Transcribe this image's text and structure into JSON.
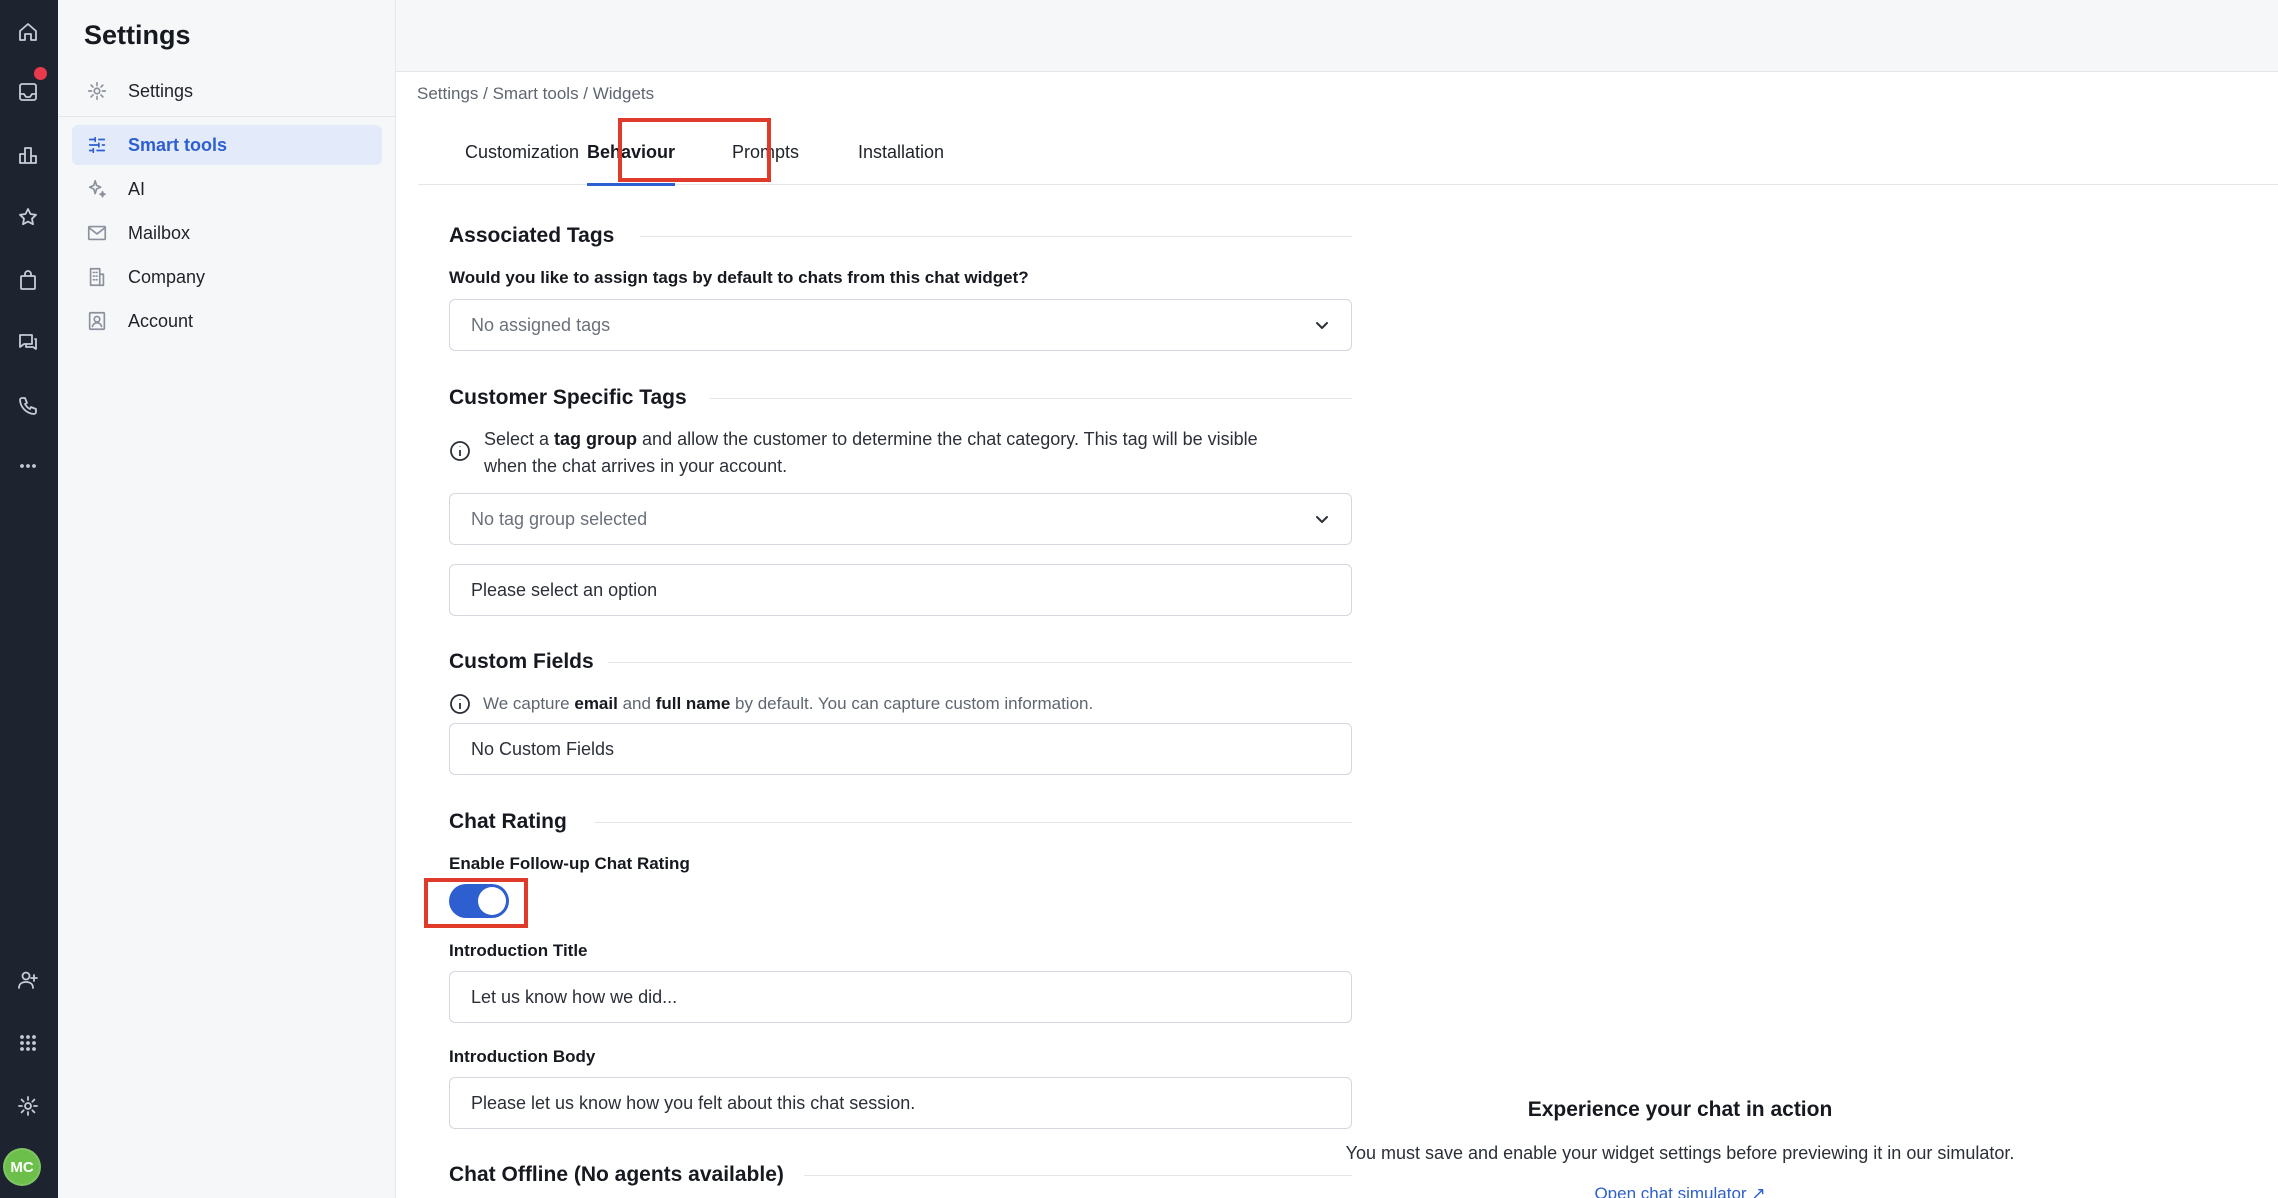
{
  "rail": {
    "icons": [
      "home-icon",
      "inbox-icon",
      "reports-icon",
      "star-icon",
      "shopping-bag-icon",
      "chat-icon",
      "phone-icon",
      "more-icon",
      "add-user-icon",
      "apps-grid-icon",
      "gear-icon"
    ],
    "avatar_initials": "MC"
  },
  "sidebar": {
    "title": "Settings",
    "items": [
      {
        "label": "Settings",
        "icon": "gear-icon"
      },
      {
        "label": "Smart tools",
        "icon": "sliders-icon",
        "active": true
      },
      {
        "label": "AI",
        "icon": "sparkle-icon"
      },
      {
        "label": "Mailbox",
        "icon": "mail-icon"
      },
      {
        "label": "Company",
        "icon": "building-icon"
      },
      {
        "label": "Account",
        "icon": "user-card-icon"
      }
    ]
  },
  "breadcrumb": "Settings / Smart tools / Widgets",
  "tabs": [
    {
      "label": "Customization"
    },
    {
      "label": "Behaviour",
      "active": true
    },
    {
      "label": "Prompts"
    },
    {
      "label": "Installation"
    }
  ],
  "associated_tags": {
    "title": "Associated Tags",
    "question": "Would you like to assign tags by default to chats from this chat widget?",
    "select_value": "No assigned tags"
  },
  "customer_tags": {
    "title": "Customer Specific Tags",
    "info_prefix": "Select a ",
    "info_bold": "tag group",
    "info_suffix": " and allow the customer to determine the chat category. This tag will be visible",
    "info_line2": "when the chat arrives in your account.",
    "select_value": "No tag group selected",
    "option_value": "Please select an option"
  },
  "custom_fields": {
    "title": "Custom Fields",
    "info_prefix": "We capture ",
    "info_bold1": "email",
    "info_mid": " and ",
    "info_bold2": "full name",
    "info_suffix": " by default. You can capture custom information.",
    "value": "No Custom Fields"
  },
  "chat_rating": {
    "title": "Chat Rating",
    "toggle_label": "Enable Follow-up Chat Rating",
    "toggle_on": true,
    "intro_title_label": "Introduction Title",
    "intro_title_value": "Let us know how we did...",
    "intro_body_label": "Introduction Body",
    "intro_body_value": "Please let us know how you felt about this chat session."
  },
  "chat_offline": {
    "title": "Chat Offline (No agents available)"
  },
  "simulator": {
    "title": "Experience your chat in action",
    "text": "You must save and enable your widget settings before previewing it in our simulator.",
    "link": "Open chat simulator"
  },
  "colors": {
    "accent": "#2e5fd0",
    "highlight": "#e03a2a",
    "rail": "#1d232f"
  }
}
